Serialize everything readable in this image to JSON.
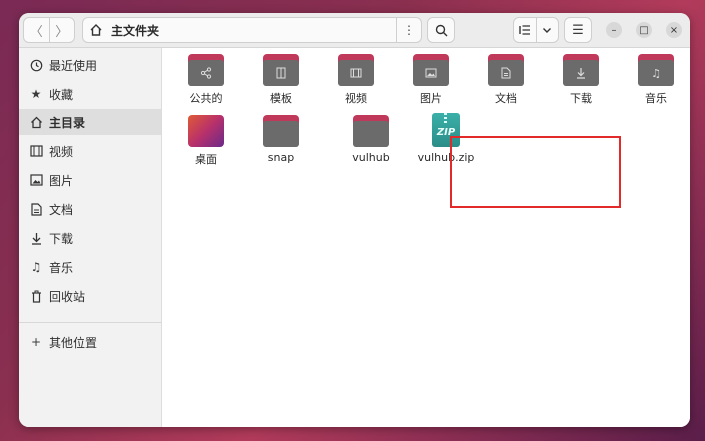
{
  "window": {
    "path": "主文件夹",
    "nav": {
      "back": "〈",
      "forward": "〉"
    },
    "menu_dots": "⋮",
    "hamburger": "☰",
    "controls": {
      "minimize": "–",
      "maximize": "□",
      "close": "×"
    }
  },
  "sidebar": {
    "items": [
      {
        "label": "最近使用",
        "icon": "clock-icon"
      },
      {
        "label": "收藏",
        "icon": "star-icon"
      },
      {
        "label": "主目录",
        "icon": "home-icon",
        "active": true
      },
      {
        "label": "视频",
        "icon": "film-icon"
      },
      {
        "label": "图片",
        "icon": "image-icon"
      },
      {
        "label": "文档",
        "icon": "document-icon"
      },
      {
        "label": "下载",
        "icon": "download-icon"
      },
      {
        "label": "音乐",
        "icon": "music-icon"
      },
      {
        "label": "回收站",
        "icon": "trash-icon"
      },
      {
        "label": "其他位置",
        "icon": "plus-icon"
      }
    ]
  },
  "files": [
    {
      "name": "公共的",
      "type": "folder",
      "glyph": "share-icon"
    },
    {
      "name": "模板",
      "type": "folder",
      "glyph": "template-icon"
    },
    {
      "name": "视频",
      "type": "folder",
      "glyph": "film-icon"
    },
    {
      "name": "图片",
      "type": "folder",
      "glyph": "image-icon"
    },
    {
      "name": "文档",
      "type": "folder",
      "glyph": "document-icon"
    },
    {
      "name": "下载",
      "type": "folder",
      "glyph": "download-icon"
    },
    {
      "name": "音乐",
      "type": "folder",
      "glyph": "music-icon"
    },
    {
      "name": "桌面",
      "type": "desktop"
    },
    {
      "name": "snap",
      "type": "folder"
    },
    {
      "name": "vulhub",
      "type": "folder"
    },
    {
      "name": "vulhub.zip",
      "type": "zip",
      "badge": "ZIP"
    }
  ],
  "colors": {
    "folder_tab": "#c0385a",
    "folder_body": "#6b6b6b",
    "highlight": "#e22a2a"
  }
}
